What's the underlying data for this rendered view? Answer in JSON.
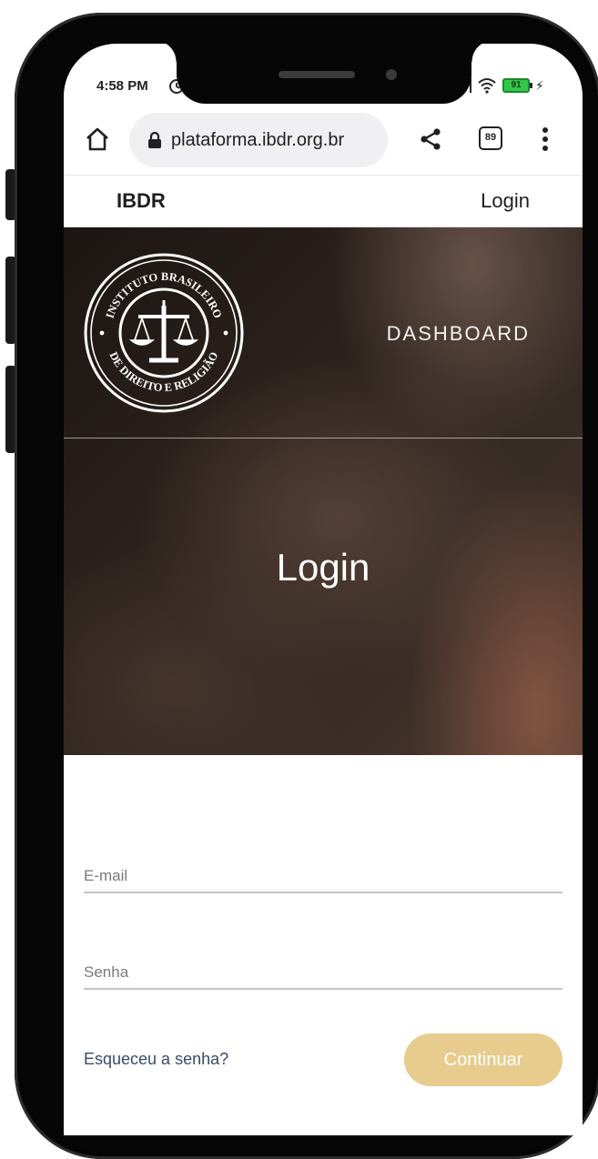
{
  "status_bar": {
    "time": "4:58 PM",
    "battery_level": "91",
    "alarm_icon": "alarm-clock-icon",
    "signal_icon": "signal-bars-icon",
    "wifi_icon": "wifi-icon",
    "battery_icon": "battery-charging-icon"
  },
  "browser": {
    "url": "plataforma.ibdr.org.br",
    "tab_count": "89",
    "home_icon": "home-icon",
    "lock_icon": "lock-icon",
    "share_icon": "share-icon",
    "menu_icon": "more-vertical-icon"
  },
  "site_nav": {
    "brand": "IBDR",
    "login_label": "Login"
  },
  "hero": {
    "logo_top_text": "INSTITUTO BRASILEIRO",
    "logo_bottom_text": "DE DIREITO E RELIGIÃO",
    "logo_icon": "scales-of-justice-icon",
    "dashboard_label": "DASHBOARD",
    "title": "Login"
  },
  "form": {
    "email_placeholder": "E-mail",
    "password_placeholder": "Senha",
    "forgot_label": "Esqueceu a senha?",
    "continue_label": "Continuar"
  },
  "colors": {
    "accent_button": "#e7cc8e",
    "link": "#3b4a66",
    "hero_dark": "#2c221d"
  }
}
